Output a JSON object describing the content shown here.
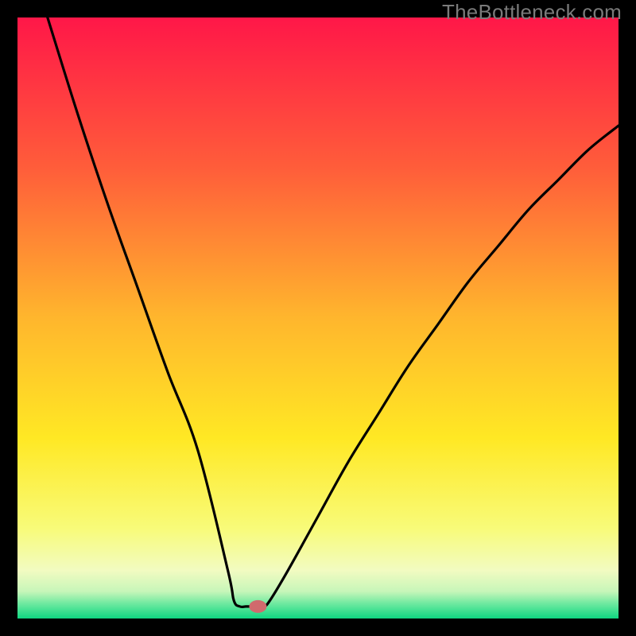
{
  "watermark": "TheBottleneck.com",
  "chart_data": {
    "type": "line",
    "title": "",
    "xlabel": "",
    "ylabel": "",
    "xlim": [
      0,
      100
    ],
    "ylim": [
      0,
      100
    ],
    "series": [
      {
        "name": "curve",
        "x": [
          5,
          10,
          15,
          20,
          25,
          30,
          35,
          36,
          37,
          38,
          39,
          40,
          41,
          42,
          45,
          50,
          55,
          60,
          65,
          70,
          75,
          80,
          85,
          90,
          95,
          100
        ],
        "y": [
          100,
          84,
          69,
          55,
          41,
          28,
          8,
          3,
          2,
          2,
          2,
          2,
          2,
          3,
          8,
          17,
          26,
          34,
          42,
          49,
          56,
          62,
          68,
          73,
          78,
          82
        ]
      }
    ],
    "marker": {
      "x": 40,
      "y": 2
    },
    "background_gradient": {
      "stops": [
        {
          "offset": 0.0,
          "color": "#ff1748"
        },
        {
          "offset": 0.25,
          "color": "#ff5d3a"
        },
        {
          "offset": 0.5,
          "color": "#ffb62d"
        },
        {
          "offset": 0.7,
          "color": "#ffe824"
        },
        {
          "offset": 0.85,
          "color": "#f8fb79"
        },
        {
          "offset": 0.92,
          "color": "#f2fbc1"
        },
        {
          "offset": 0.955,
          "color": "#c7f6b9"
        },
        {
          "offset": 0.975,
          "color": "#6fe9a0"
        },
        {
          "offset": 1.0,
          "color": "#0fd781"
        }
      ]
    }
  }
}
